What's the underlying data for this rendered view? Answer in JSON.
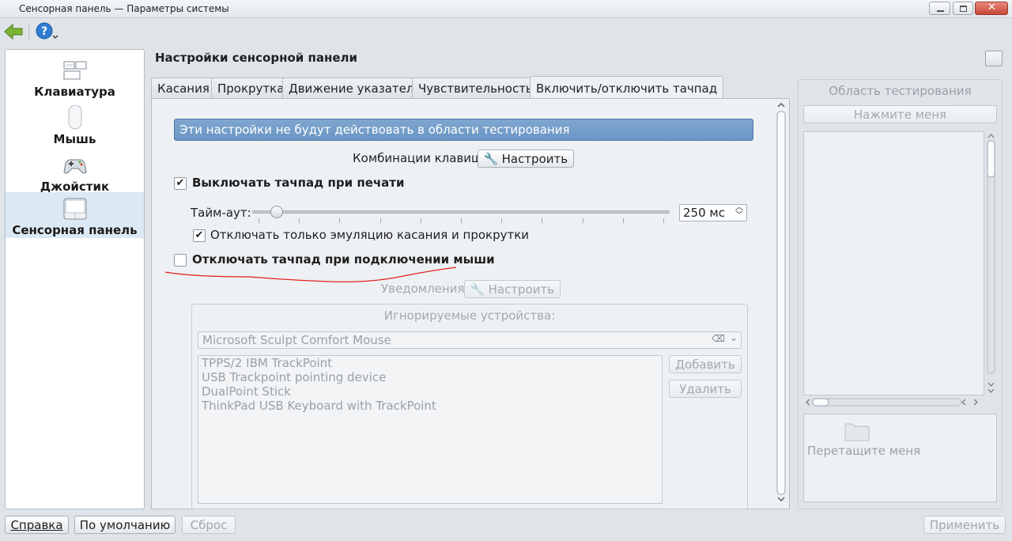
{
  "window": {
    "title": "Сенсорная панель — Параметры системы"
  },
  "sidebar": {
    "items": [
      {
        "label": "Клавиатура",
        "icon": "keyboard-icon"
      },
      {
        "label": "Мышь",
        "icon": "mouse-icon"
      },
      {
        "label": "Джойстик",
        "icon": "gamepad-icon"
      },
      {
        "label": "Сенсорная панель",
        "icon": "touchpad-icon",
        "active": true
      }
    ]
  },
  "main": {
    "title": "Настройки сенсорной панели",
    "tabs": [
      {
        "label": "Касания"
      },
      {
        "label": "Прокрутка"
      },
      {
        "label": "Движение указателя"
      },
      {
        "label": "Чувствительность"
      },
      {
        "label": "Включить/отключить тачпад",
        "active": true
      }
    ],
    "banner": "Эти настройки не будут действовать в области тестирования",
    "shortcuts_label": "Комбинации клавиш:",
    "configure_label": "Настроить",
    "disable_while_typing": {
      "label": "Выключать тачпад при печати",
      "checked": true
    },
    "timeout": {
      "label": "Тайм-аут:",
      "value": "250 мс",
      "fraction": 0.03
    },
    "only_tap_scroll": {
      "label": "Отключать только эмуляцию касания и прокрутки",
      "checked": true
    },
    "disable_with_mouse": {
      "label": "Отключать тачпад при подключении мыши",
      "checked": false
    },
    "notifications_label": "Уведомления:",
    "notifications_configure": "Настроить",
    "ignored_devices": {
      "title": "Игнорируемые устройства:",
      "combo_value": "Microsoft Sculpt Comfort Mouse",
      "items": [
        "TPPS/2 IBM TrackPoint",
        "USB Trackpoint pointing device",
        "DualPoint Stick",
        "ThinkPad USB Keyboard with TrackPoint"
      ],
      "add_label": "Добавить",
      "remove_label": "Удалить"
    }
  },
  "test_area": {
    "title": "Область тестирования",
    "press_me": "Нажмите меня",
    "drag_me": "Перетащите меня"
  },
  "bottom": {
    "help": "Справка",
    "defaults": "По умолчанию",
    "reset": "Сброс",
    "apply": "Применить"
  },
  "colors": {
    "banner": "#7fa6cf",
    "window_bg": "#dfe4e9",
    "annotation": "#e3201b"
  }
}
